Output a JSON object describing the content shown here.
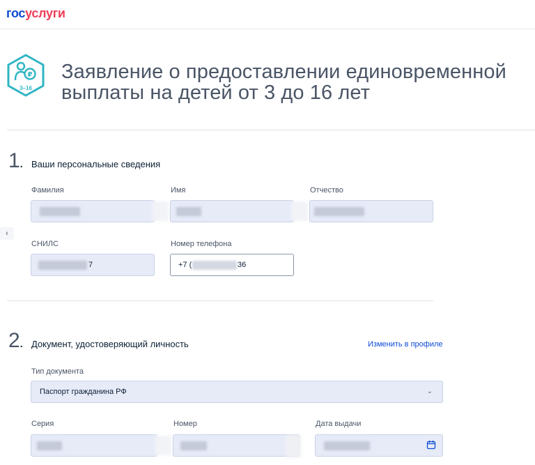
{
  "header": {
    "logo_part1": "гос",
    "logo_part2": "услуги"
  },
  "hero": {
    "icon_caption": "3–16",
    "title_line1": "Заявление о предоставлении единовременной",
    "title_line2": "выплаты на детей от 3 до 16 лет"
  },
  "section1": {
    "number": "1",
    "title": "Ваши персональные сведения",
    "fields": {
      "surname_label": "Фамилия",
      "name_label": "Имя",
      "patronymic_label": "Отчество",
      "snils_label": "СНИЛС",
      "snils_value_suffix": "7",
      "phone_label": "Номер телефона",
      "phone_prefix": "+7 (",
      "phone_suffix": "36"
    }
  },
  "section2": {
    "number": "2",
    "title": "Документ, удостоверяющий личность",
    "edit_link": "Изменить в профиле",
    "doc_type_label": "Тип документа",
    "doc_type_value": "Паспорт гражданина РФ",
    "series_label": "Серия",
    "number_label": "Номер",
    "issue_date_label": "Дата выдачи"
  },
  "nav": {
    "back_arrow": "‹"
  },
  "colors": {
    "brand_blue": "#0d4cd3",
    "brand_red": "#ee3f58",
    "teal_icon": "#2fb5c4"
  }
}
